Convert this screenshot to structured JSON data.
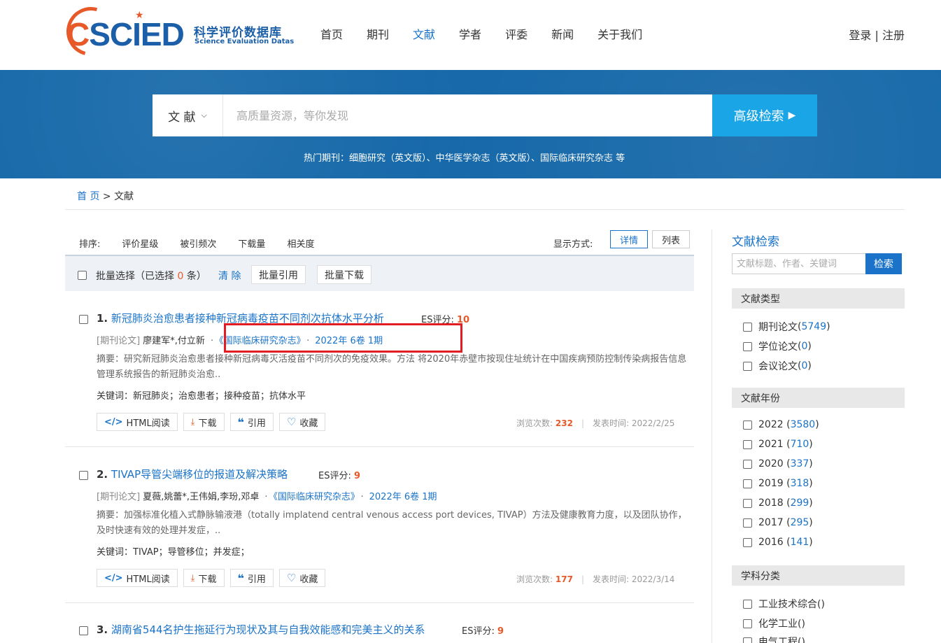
{
  "header": {
    "logo_word_c": "C",
    "logo_word_rest": "SCIED",
    "logo_cn": "科学评价数据库",
    "logo_en": "Science Evaluation Datas",
    "nav": [
      "首页",
      "期刊",
      "文献",
      "学者",
      "评委",
      "新闻",
      "关于我们"
    ],
    "active_nav": "文献",
    "auth": "登录 | 注册"
  },
  "search": {
    "scope": "文 献",
    "placeholder": "高质量资源，等你发现",
    "advanced": "高级检索",
    "hot": "热门期刊：细胞研究（英文版）、中华医学杂志（英文版）、国际临床研究杂志 等"
  },
  "breadcrumb": {
    "home": "首 页",
    "sep": " > ",
    "current": "文献"
  },
  "sort": {
    "label": "排序:",
    "options": [
      "评价星级",
      "被引频次",
      "下载量",
      "相关度"
    ],
    "display_label": "显示方式:",
    "view_detail": "详情",
    "view_list": "列表"
  },
  "batch": {
    "select_prefix": "批量选择（已选择 ",
    "selected_count": "0",
    "select_suffix": " 条）",
    "clear": "清 除",
    "cite": "批量引用",
    "download": "批量下载"
  },
  "results": [
    {
      "index": "1.",
      "title": "新冠肺炎治愈患者接种新冠病毒疫苗不同剂次抗体水平分析",
      "es_label": "ES评分:",
      "es_score": "10",
      "type": "[期刊论文]",
      "authors": "廖建军*,付立新",
      "journal": "《国际临床研究杂志》",
      "issue": "2022年 6卷 1期",
      "abstract": "摘要：研究新冠肺炎治愈患者接种新冠病毒灭活疫苗不同剂次的免疫效果。方法 将2020年赤壁市按现住址统计在中国疾病预防控制传染病报告信息管理系统报告的新冠肺炎治愈..",
      "keywords": "关键词：新冠肺炎；治愈患者；接种疫苗；抗体水平",
      "views_label": "浏览次数:",
      "views": "232",
      "date_label": "发表时间:",
      "date": "2022/2/25"
    },
    {
      "index": "2.",
      "title": "TIVAP导管尖端移位的报道及解决策略",
      "es_label": "ES评分:",
      "es_score": "9",
      "type": "[期刊论文]",
      "authors": "夏薇,姚蕾*,王伟娟,李玢,邓卓",
      "journal": "《国际临床研究杂志》",
      "issue": "2022年 6卷 1期",
      "abstract": "摘要：加强标准化植入式静脉输液港（totally implatend central venous access port devices, TIVAP）方法及健康教育力度，以及团队协作，及时快速有效的处理并发症，..",
      "keywords": "关键词：TIVAP；导管移位；并发症；",
      "views_label": "浏览次数:",
      "views": "177",
      "date_label": "发表时间:",
      "date": "2022/3/14"
    },
    {
      "index": "3.",
      "title": "湖南省544名护生拖延行为现状及其与自我效能感和完美主义的关系",
      "es_label": "ES评分:",
      "es_score": "9"
    }
  ],
  "actions": {
    "html_read": "HTML阅读",
    "download": "下载",
    "cite": "引用",
    "collect": "收藏"
  },
  "sidebar": {
    "title": "文献检索",
    "search_placeholder": "文献标题、作者、关键词",
    "search_button": "检索",
    "doc_type_title": "文献类型",
    "doc_types": [
      {
        "label": "期刊论文",
        "count": "5749"
      },
      {
        "label": "学位论文",
        "count": "0"
      },
      {
        "label": "会议论文",
        "count": "0"
      }
    ],
    "year_title": "文献年份",
    "years": [
      {
        "label": "2022",
        "count": "3580"
      },
      {
        "label": "2021",
        "count": "710"
      },
      {
        "label": "2020",
        "count": "337"
      },
      {
        "label": "2019",
        "count": "318"
      },
      {
        "label": "2018",
        "count": "299"
      },
      {
        "label": "2017",
        "count": "295"
      },
      {
        "label": "2016",
        "count": "141"
      }
    ],
    "subject_title": "学科分类",
    "subjects": [
      "工业技术综合()",
      "化学工业()",
      "电气工程()"
    ]
  },
  "colors": {
    "primary": "#1a73c8",
    "banner": "#1467a8",
    "accent": "#e8592a",
    "highlight": "#e31b23"
  }
}
